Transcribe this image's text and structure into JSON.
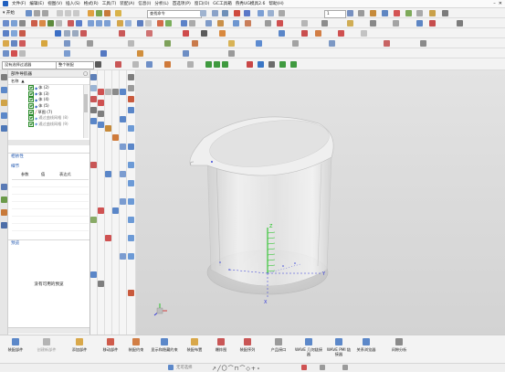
{
  "menubar": {
    "items": [
      "文件(F)",
      "编辑(E)",
      "视图(V)",
      "插入(S)",
      "格式(R)",
      "工具(T)",
      "装配(A)",
      "信息(I)",
      "分析(L)",
      "首选项(P)",
      "窗口(O)",
      "GC工具箱",
      "燕秀UG模具2.6",
      "帮助(H)"
    ]
  },
  "toolbar": {
    "start_label": "开始",
    "command_search": "查找命令",
    "filter_left": "没有选择过滤器",
    "filter_right": "整个装配",
    "layer_value": "1"
  },
  "navigator": {
    "title": "部件导航器",
    "col_name": "名称",
    "tree": [
      {
        "label": "体 (2)",
        "checked": true
      },
      {
        "label": "体 (3)",
        "checked": true
      },
      {
        "label": "体 (4)",
        "checked": true
      },
      {
        "label": "体 (5)",
        "checked": true
      },
      {
        "label": "草图 (7)",
        "checked": true
      },
      {
        "label": "通过曲线网格 (8)",
        "checked": true
      },
      {
        "label": "通过曲线网格 (9)",
        "checked": true
      }
    ],
    "dependencies": "相依性",
    "details": "细节",
    "details_cols": [
      "参数",
      "值",
      "表达式"
    ],
    "preview": "预览",
    "no_preview": "没有可用的预览"
  },
  "bottom": {
    "buttons": [
      "装配部件",
      "创建新部件",
      "添加部件",
      "移动部件",
      "装配约束",
      "显示和隐藏约束",
      "装配布置",
      "爆炸图",
      "装配序列",
      "产品接口",
      "WAVE 几何链接器",
      "WAVE PMI 链接器",
      "关系浏览器",
      "间隙分析"
    ]
  },
  "status": {
    "text": "无可选择"
  },
  "colors": {
    "accent": "#2b5fb3",
    "axis_x": "#2f35d8",
    "axis_y": "#2f35d8",
    "axis_z": "#17c017"
  }
}
